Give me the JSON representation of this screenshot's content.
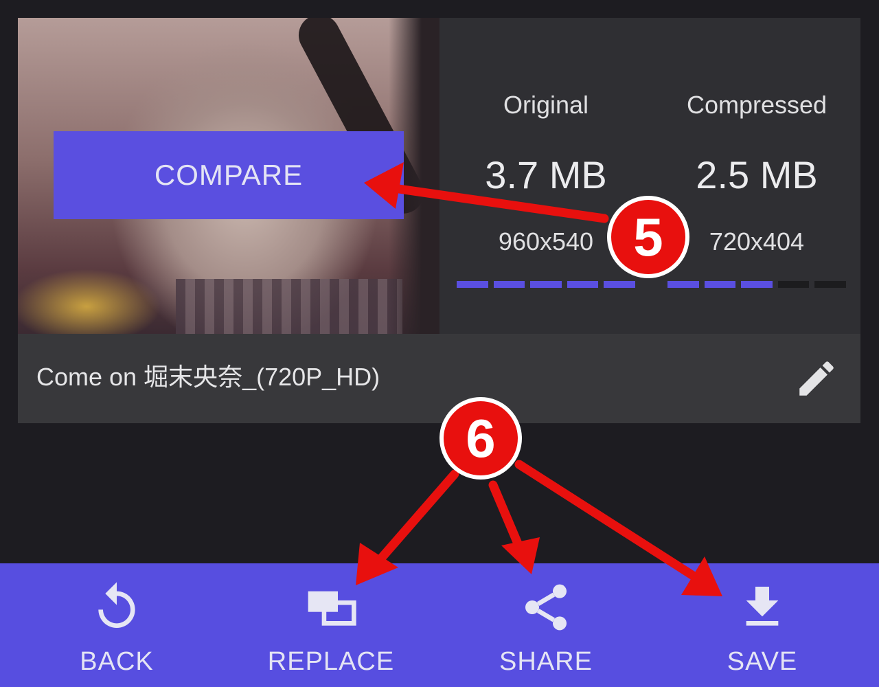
{
  "video": {
    "compare_label": "COMPARE",
    "file_name": "Come on 堀末央奈_(720P_HD)"
  },
  "stats": {
    "original": {
      "label": "Original",
      "size": "3.7 MB",
      "resolution": "960x540",
      "bar_segments_on": 5,
      "bar_segments_total": 5
    },
    "compressed": {
      "label": "Compressed",
      "size": "2.5 MB",
      "resolution": "720x404",
      "bar_segments_on": 3,
      "bar_segments_total": 5
    }
  },
  "actions": [
    {
      "id": "back",
      "label": "BACK",
      "icon": "undo-icon"
    },
    {
      "id": "replace",
      "label": "REPLACE",
      "icon": "replace-icon"
    },
    {
      "id": "share",
      "label": "SHARE",
      "icon": "share-icon"
    },
    {
      "id": "save",
      "label": "SAVE",
      "icon": "download-icon"
    }
  ],
  "annotations": {
    "step_a": "5",
    "step_b": "6",
    "color": "#e8100e"
  },
  "colors": {
    "accent": "#574ee0",
    "background": "#1d1c21",
    "card": "#38383b"
  }
}
